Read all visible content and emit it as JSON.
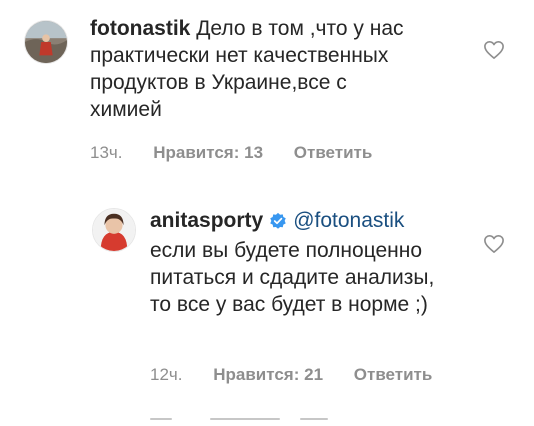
{
  "comments": [
    {
      "username": "fotonastik",
      "text": "Дело в том ,что у нас практически нет качественных продуктов в Украине,все с химией",
      "time": "13ч.",
      "likes": "Нравится: 13",
      "reply": "Ответить"
    },
    {
      "username": "anitasporty",
      "mention": "@fotonastik",
      "text": "если вы будете полноценно питаться и сдадите анализы, то все у вас будет в норме ;)",
      "time": "12ч.",
      "likes": "Нравится: 21",
      "reply": "Ответить"
    }
  ],
  "icons": {
    "like": "heart-outline-icon",
    "verified": "verified-badge-icon"
  },
  "colors": {
    "text": "#262626",
    "meta": "#8e8e8e",
    "mention": "#1a4f80",
    "verified": "#3897f0"
  }
}
